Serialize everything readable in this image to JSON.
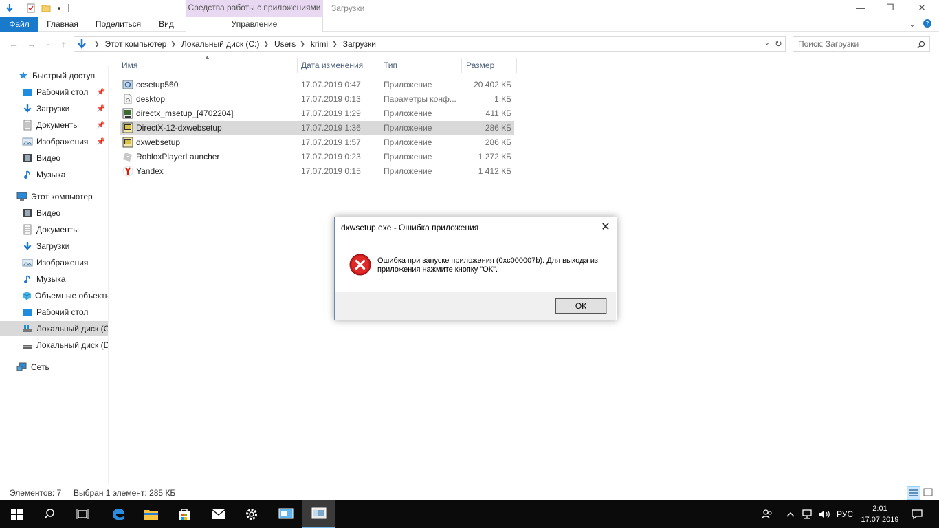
{
  "window": {
    "context_tab_group": "Средства работы с приложениями",
    "title": "Загрузки",
    "minimize": "—",
    "restore": "❐",
    "close": "✕"
  },
  "ribbon": {
    "file": "Файл",
    "home": "Главная",
    "share": "Поделиться",
    "view": "Вид",
    "manage": "Управление"
  },
  "address": {
    "crumbs": [
      "Этот компьютер",
      "Локальный диск (C:)",
      "Users",
      "krimi",
      "Загрузки"
    ],
    "search_placeholder": "Поиск: Загрузки"
  },
  "nav": {
    "quick_access": "Быстрый доступ",
    "quick_items": [
      "Рабочий стол",
      "Загрузки",
      "Документы",
      "Изображения",
      "Видео",
      "Музыка"
    ],
    "this_pc": "Этот компьютер",
    "pc_items": [
      "Видео",
      "Документы",
      "Загрузки",
      "Изображения",
      "Музыка",
      "Объемные объекты",
      "Рабочий стол",
      "Локальный диск (C:)",
      "Локальный диск (D:)"
    ],
    "network": "Сеть"
  },
  "columns": {
    "name": "Имя",
    "date": "Дата изменения",
    "type": "Тип",
    "size": "Размер"
  },
  "files": [
    {
      "name": "ccsetup560",
      "date": "17.07.2019 0:47",
      "type": "Приложение",
      "size": "20 402 КБ"
    },
    {
      "name": "desktop",
      "date": "17.07.2019 0:13",
      "type": "Параметры конф...",
      "size": "1 КБ"
    },
    {
      "name": "directx_msetup_[4702204]",
      "date": "17.07.2019 1:29",
      "type": "Приложение",
      "size": "411 КБ"
    },
    {
      "name": "DirectX-12-dxwebsetup",
      "date": "17.07.2019 1:36",
      "type": "Приложение",
      "size": "286 КБ"
    },
    {
      "name": "dxwebsetup",
      "date": "17.07.2019 1:57",
      "type": "Приложение",
      "size": "286 КБ"
    },
    {
      "name": "RobloxPlayerLauncher",
      "date": "17.07.2019 0:23",
      "type": "Приложение",
      "size": "1 272 КБ"
    },
    {
      "name": "Yandex",
      "date": "17.07.2019 0:15",
      "type": "Приложение",
      "size": "1 412 КБ"
    }
  ],
  "status": {
    "count": "Элементов: 7",
    "selected": "Выбран 1 элемент: 285 КБ"
  },
  "dialog": {
    "title": "dxwsetup.exe - Ошибка приложения",
    "message": "Ошибка при запуске приложения (0xc000007b). Для выхода из приложения нажмите кнопку \"ОК\".",
    "ok": "ОК"
  },
  "taskbar": {
    "lang": "РУС",
    "time": "2:01",
    "date": "17.07.2019"
  }
}
